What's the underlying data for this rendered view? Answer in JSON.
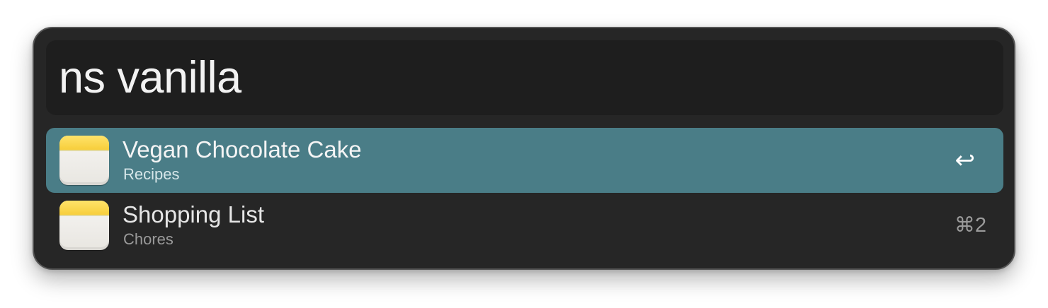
{
  "search": {
    "query": "ns vanilla"
  },
  "results": [
    {
      "title": "Vegan Chocolate Cake",
      "subtitle": "Recipes",
      "shortcut": "↩",
      "icon": "notes-app-icon",
      "selected": true
    },
    {
      "title": "Shopping List",
      "subtitle": "Chores",
      "shortcut": "⌘2",
      "icon": "notes-app-icon",
      "selected": false
    }
  ],
  "colors": {
    "window_bg": "#262626",
    "search_bg": "#1e1e1e",
    "selection": "#4a7d87",
    "notes_yellow": "#f7ce3b"
  }
}
